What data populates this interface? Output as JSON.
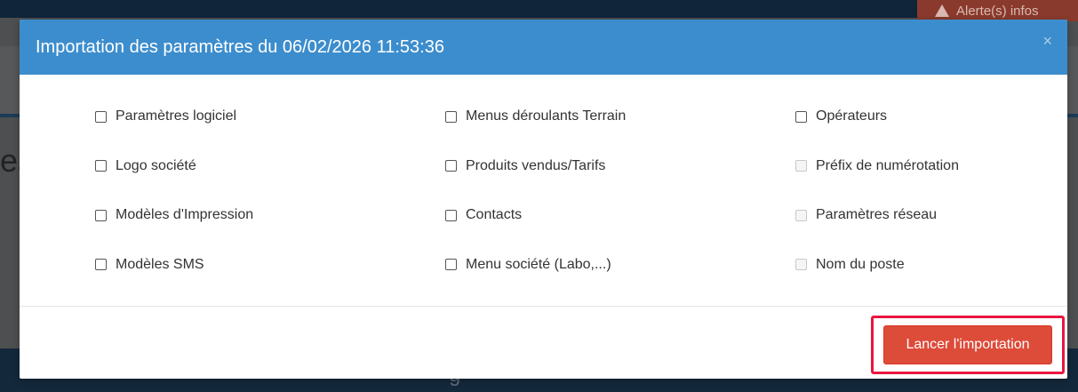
{
  "background": {
    "alert_label": "Alerte(s) infos",
    "left_fragment": "es",
    "bottom_fragment": "g"
  },
  "modal": {
    "title": "Importation des paramètres du 06/02/2026 11:53:36",
    "close_glyph": "×",
    "options": [
      {
        "label": "Paramètres logiciel",
        "disabled": false
      },
      {
        "label": "Menus déroulants Terrain",
        "disabled": false
      },
      {
        "label": "Opérateurs",
        "disabled": false
      },
      {
        "label": "Logo société",
        "disabled": false
      },
      {
        "label": "Produits vendus/Tarifs",
        "disabled": false
      },
      {
        "label": "Préfix de numérotation",
        "disabled": true
      },
      {
        "label": "Modèles d'Impression",
        "disabled": false
      },
      {
        "label": "Contacts",
        "disabled": false
      },
      {
        "label": "Paramètres réseau",
        "disabled": true
      },
      {
        "label": "Modèles SMS",
        "disabled": false
      },
      {
        "label": "Menu société (Labo,...)",
        "disabled": false
      },
      {
        "label": "Nom du poste",
        "disabled": true
      }
    ],
    "submit_label": "Lancer l'importation"
  },
  "colors": {
    "header": "#3c8dcd",
    "primary_button": "#dd4b39",
    "highlight_border": "#e8163f"
  }
}
